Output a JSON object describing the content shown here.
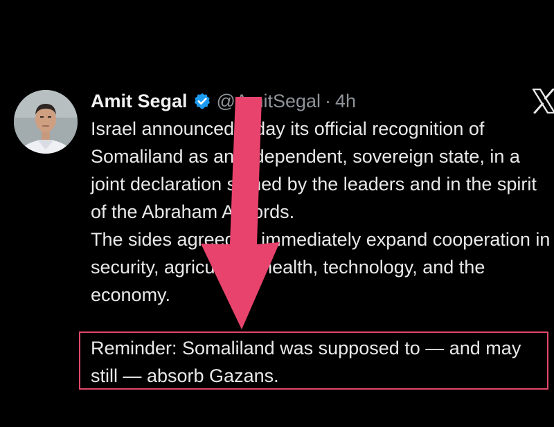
{
  "tweet": {
    "author": {
      "display_name": "Amit Segal",
      "verified": true,
      "handle": "@AmitSegal",
      "separator": "·",
      "time": "4h"
    },
    "body_paragraphs": [
      "Israel announced today its official recognition of Somaliland as an independent, sovereign state, in a joint declaration signed by the leaders and in the spirit of the Abraham Accords.",
      "The sides agreed to immediately expand cooperation in security, agriculture, health, technology, and the economy."
    ],
    "highlighted_paragraph": "Reminder: Somaliland was supposed to — and may still — absorb Gazans."
  },
  "icons": {
    "avatar": "avatar-photo",
    "verified": "verified-badge-icon",
    "brand": "x-logo-icon",
    "annotation": "down-arrow-annotation"
  },
  "colors": {
    "background": "#000000",
    "text": "#e9e9e9",
    "muted": "#8f9499",
    "verified_badge": "#1d9bf0",
    "annotation": "#e24868"
  }
}
